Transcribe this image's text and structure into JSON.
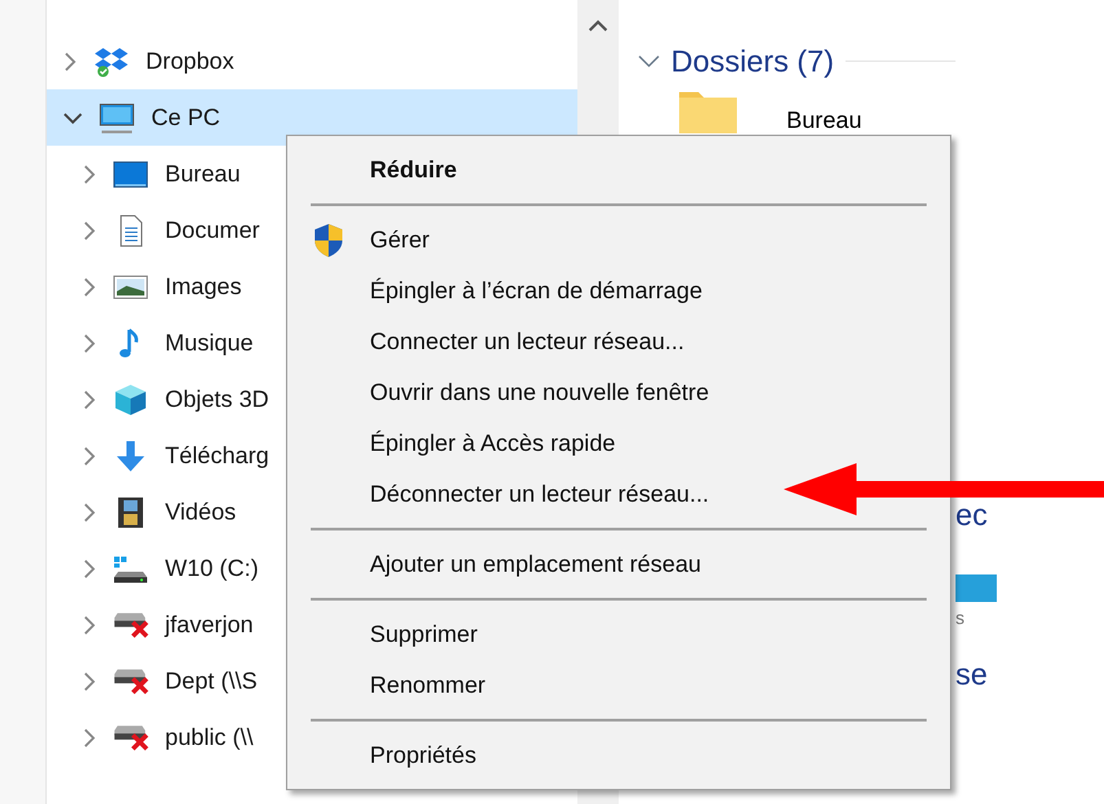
{
  "tree": [
    {
      "label": "Dropbox",
      "kind": "dropbox",
      "expanded": false,
      "selected": false
    },
    {
      "label": "Ce PC",
      "kind": "pc",
      "expanded": true,
      "selected": true,
      "children": [
        {
          "label": "Bureau",
          "kind": "desktop",
          "expanded": false,
          "selected": false
        },
        {
          "label": "Documer",
          "kind": "documents",
          "expanded": false,
          "selected": false
        },
        {
          "label": "Images",
          "kind": "pictures",
          "expanded": false,
          "selected": false
        },
        {
          "label": "Musique",
          "kind": "music",
          "expanded": false,
          "selected": false
        },
        {
          "label": "Objets 3D",
          "kind": "objects",
          "expanded": false,
          "selected": false
        },
        {
          "label": "Télécharg",
          "kind": "downloads",
          "expanded": false,
          "selected": false
        },
        {
          "label": "Vidéos",
          "kind": "videos",
          "expanded": false,
          "selected": false
        },
        {
          "label": "W10 (C:)",
          "kind": "drive",
          "expanded": false,
          "selected": false
        },
        {
          "label": "jfaverjon",
          "kind": "netdrive",
          "expanded": false,
          "selected": false
        },
        {
          "label": "Dept (\\\\S",
          "kind": "netdrive",
          "expanded": false,
          "selected": false
        },
        {
          "label": "public (\\\\",
          "kind": "netdrive",
          "expanded": false,
          "selected": false
        }
      ]
    }
  ],
  "content": {
    "header": "Dossiers (7)",
    "folder_label": "Bureau",
    "fragments": [
      "ec",
      "s",
      "se"
    ]
  },
  "context_menu": [
    {
      "kind": "default",
      "label": "Réduire"
    },
    {
      "kind": "separator"
    },
    {
      "kind": "shield",
      "label": "Gérer"
    },
    {
      "kind": "item",
      "label": "Épingler à l’écran de démarrage"
    },
    {
      "kind": "item",
      "label": "Connecter un lecteur réseau..."
    },
    {
      "kind": "item",
      "label": "Ouvrir dans une nouvelle fenêtre"
    },
    {
      "kind": "item",
      "label": "Épingler à Accès rapide"
    },
    {
      "kind": "item",
      "label": "Déconnecter un lecteur réseau...",
      "highlighted": true
    },
    {
      "kind": "separator"
    },
    {
      "kind": "item",
      "label": "Ajouter un emplacement réseau"
    },
    {
      "kind": "separator"
    },
    {
      "kind": "item",
      "label": "Supprimer"
    },
    {
      "kind": "item",
      "label": "Renommer"
    },
    {
      "kind": "separator"
    },
    {
      "kind": "item",
      "label": "Propriétés"
    }
  ]
}
